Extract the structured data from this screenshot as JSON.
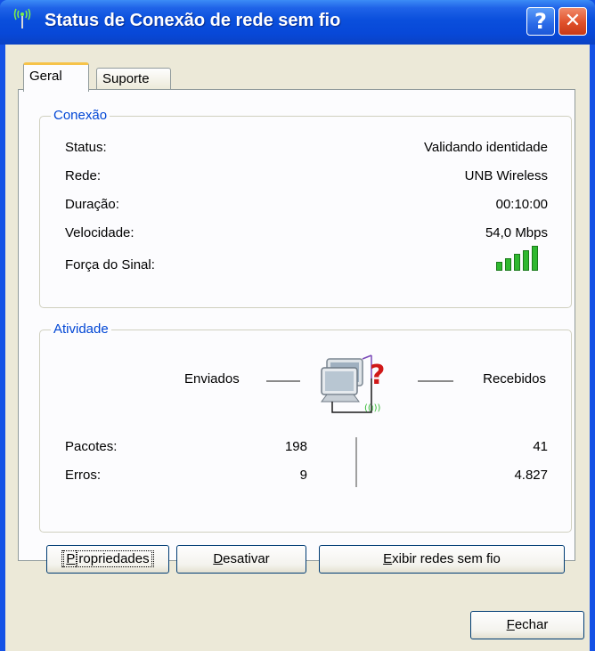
{
  "window": {
    "title": "Status de Conexão de rede sem fio",
    "help_glyph": "?",
    "close_glyph": "✕"
  },
  "tabs": [
    {
      "label": "Geral",
      "active": true
    },
    {
      "label": "Suporte",
      "active": false
    }
  ],
  "connection": {
    "group_label": "Conexão",
    "rows": [
      {
        "label": "Status:",
        "value": "Validando identidade"
      },
      {
        "label": "Rede:",
        "value": "UNB Wireless"
      },
      {
        "label": "Duração:",
        "value": "00:10:00"
      },
      {
        "label": "Velocidade:",
        "value": "54,0 Mbps"
      }
    ],
    "signal_label": "Força do Sinal:",
    "signal_bars_lit": 5,
    "signal_bars_total": 5,
    "signal_color": "#2fb82f"
  },
  "activity": {
    "group_label": "Atividade",
    "sent_label": "Enviados",
    "received_label": "Recebidos",
    "icon": "network-computers-icon",
    "rows": [
      {
        "label": "Pacotes:",
        "sent": "198",
        "received": "41"
      },
      {
        "label": "Erros:",
        "sent": "9",
        "received": "4.827"
      }
    ]
  },
  "buttons": {
    "properties": {
      "mnemonic": "P",
      "rest": "ropriedades"
    },
    "disable": {
      "mnemonic": "D",
      "rest": "esativar"
    },
    "view_networks": {
      "mnemonic": "E",
      "rest": "xibir redes sem fio"
    },
    "close": {
      "mnemonic": "F",
      "rest": "echar"
    }
  },
  "colors": {
    "title_bar": "#0a4fdc",
    "group_label": "#0046d5",
    "dialog_bg": "#ece9d8",
    "error_question": "#d01818"
  }
}
